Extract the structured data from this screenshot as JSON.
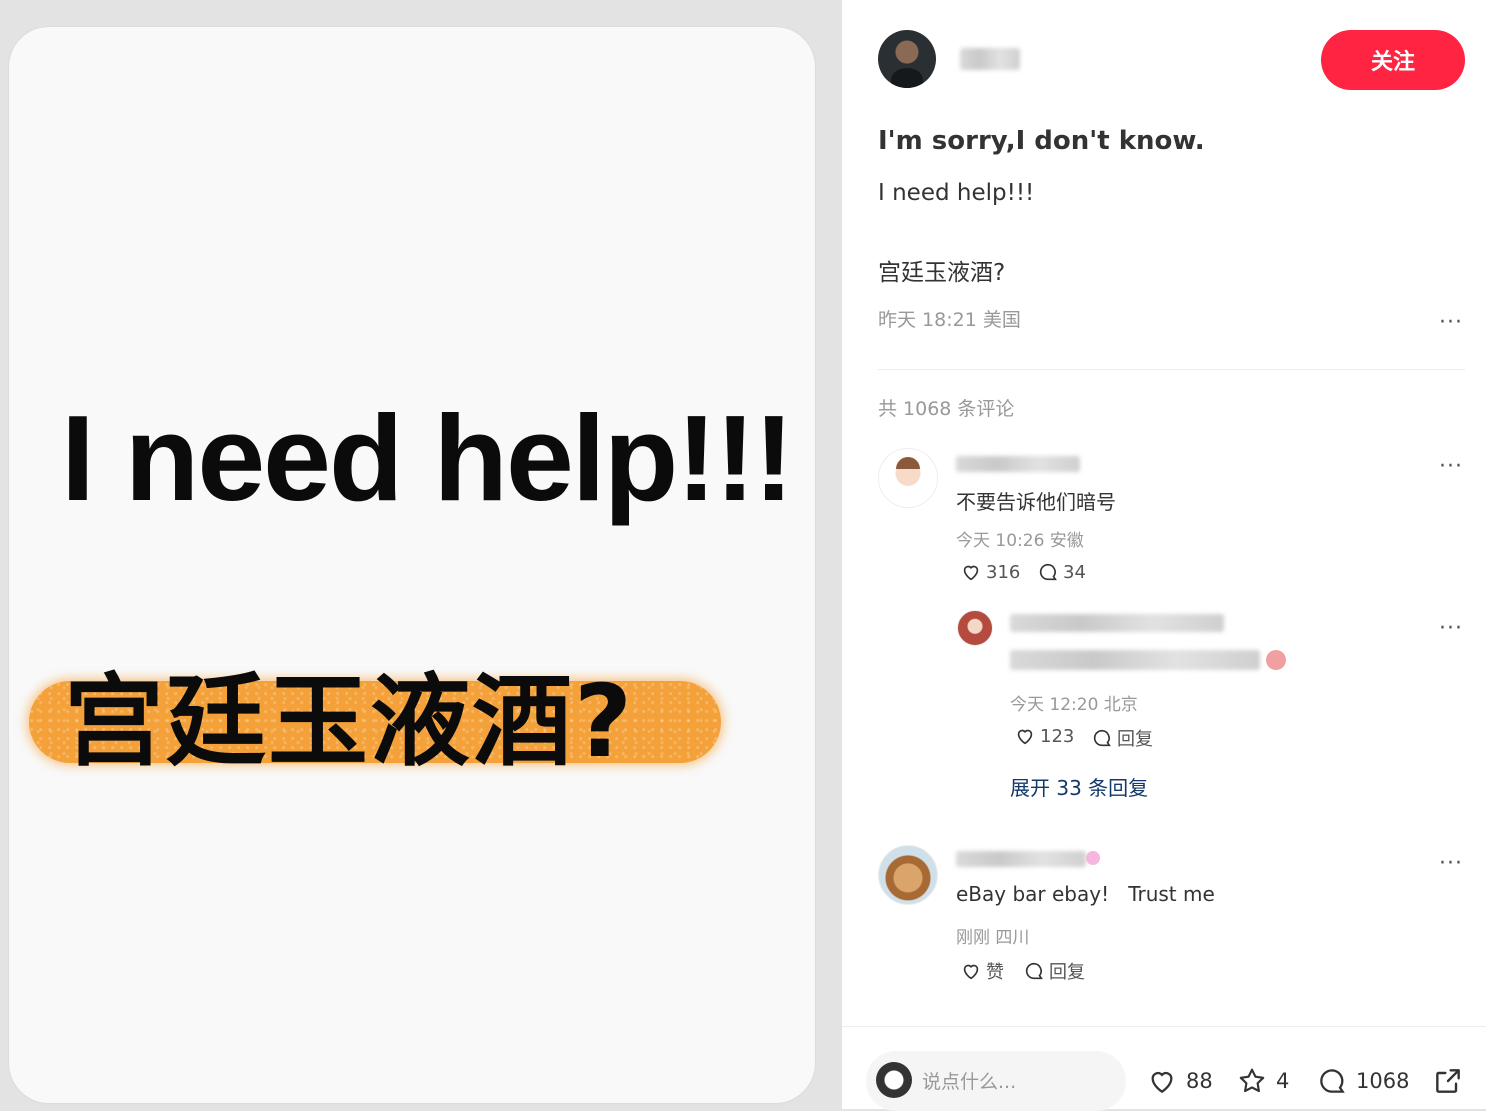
{
  "image_card": {
    "headline": "I need help!!!",
    "highlight": "宫廷玉液酒?"
  },
  "author": {
    "follow_label": "关注"
  },
  "post": {
    "title": "I'm sorry,I don't know.",
    "line1": "I need help!!!",
    "line2": "宫廷玉液酒?",
    "meta": "昨天 18:21 美国",
    "more": "···"
  },
  "comments": {
    "count_label": "共 1068 条评论",
    "items": [
      {
        "text": "不要告诉他们暗号",
        "meta": "今天 10:26 安徽",
        "likes": "316",
        "replies": "34",
        "more": "···"
      },
      {
        "meta": "今天 12:20 北京",
        "likes": "123",
        "reply_label": "回复",
        "more": "···"
      },
      {
        "text": "eBay bar ebay!   Trust me",
        "meta": "刚刚 四川",
        "like_label": "赞",
        "reply_label": "回复",
        "more": "···"
      }
    ],
    "expand_label": "展开 33 条回复"
  },
  "bottom_bar": {
    "placeholder": "说点什么...",
    "likes": "88",
    "stars": "4",
    "comments": "1068"
  },
  "colors": {
    "accent": "#ff2442",
    "link": "#13386c",
    "highlight_brush": "#f4a13a"
  },
  "icons": [
    "heart-icon",
    "chat-bubble-icon",
    "star-icon",
    "share-icon",
    "more-icon"
  ]
}
